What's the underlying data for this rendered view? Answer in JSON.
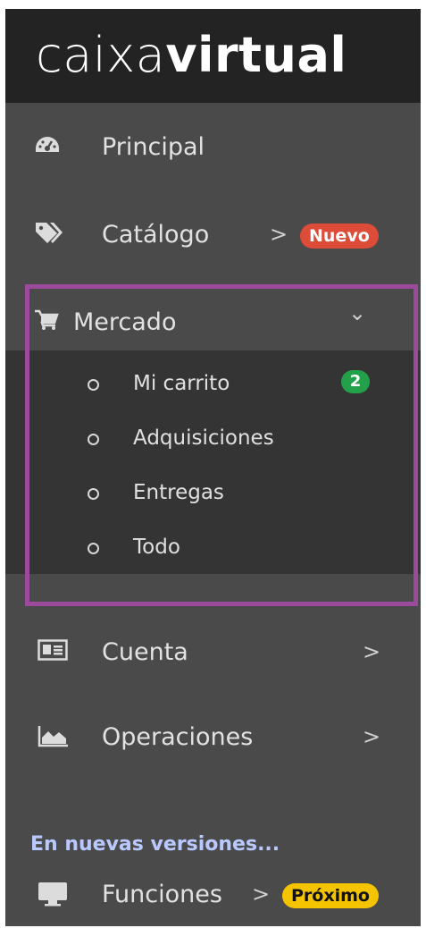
{
  "brand": {
    "part1": "caixa",
    "part2": "virtual"
  },
  "menu": {
    "principal": {
      "label": "Principal",
      "icon": "dashboard-icon"
    },
    "catalogo": {
      "label": "Catálogo",
      "chevron": ">",
      "badge": "Nuevo",
      "icon": "tags-icon"
    },
    "mercado": {
      "label": "Mercado",
      "chevron": "⌄",
      "icon": "cart-icon"
    },
    "cuenta": {
      "label": "Cuenta",
      "chevron": ">",
      "icon": "id-card-icon"
    },
    "operaciones": {
      "label": "Operaciones",
      "chevron": ">",
      "icon": "area-chart-icon"
    }
  },
  "submenu": {
    "items": [
      {
        "label": "Mi carrito",
        "badge": "2"
      },
      {
        "label": "Adquisiciones"
      },
      {
        "label": "Entregas"
      },
      {
        "label": "Todo"
      }
    ]
  },
  "section": {
    "title": "En nuevas versiones..."
  },
  "funciones": {
    "label": "Funciones",
    "chevron": ">",
    "badge": "Próximo",
    "icon": "desktop-icon"
  },
  "colors": {
    "sidebar_bg": "#4a4a4a",
    "header_bg": "#232323",
    "submenu_bg": "#343434",
    "highlight": "#9b4a9c",
    "badge_red": "#dd4b39",
    "badge_green": "#22a14a",
    "badge_yellow": "#f5c400",
    "section_title": "#b9c9ff"
  }
}
